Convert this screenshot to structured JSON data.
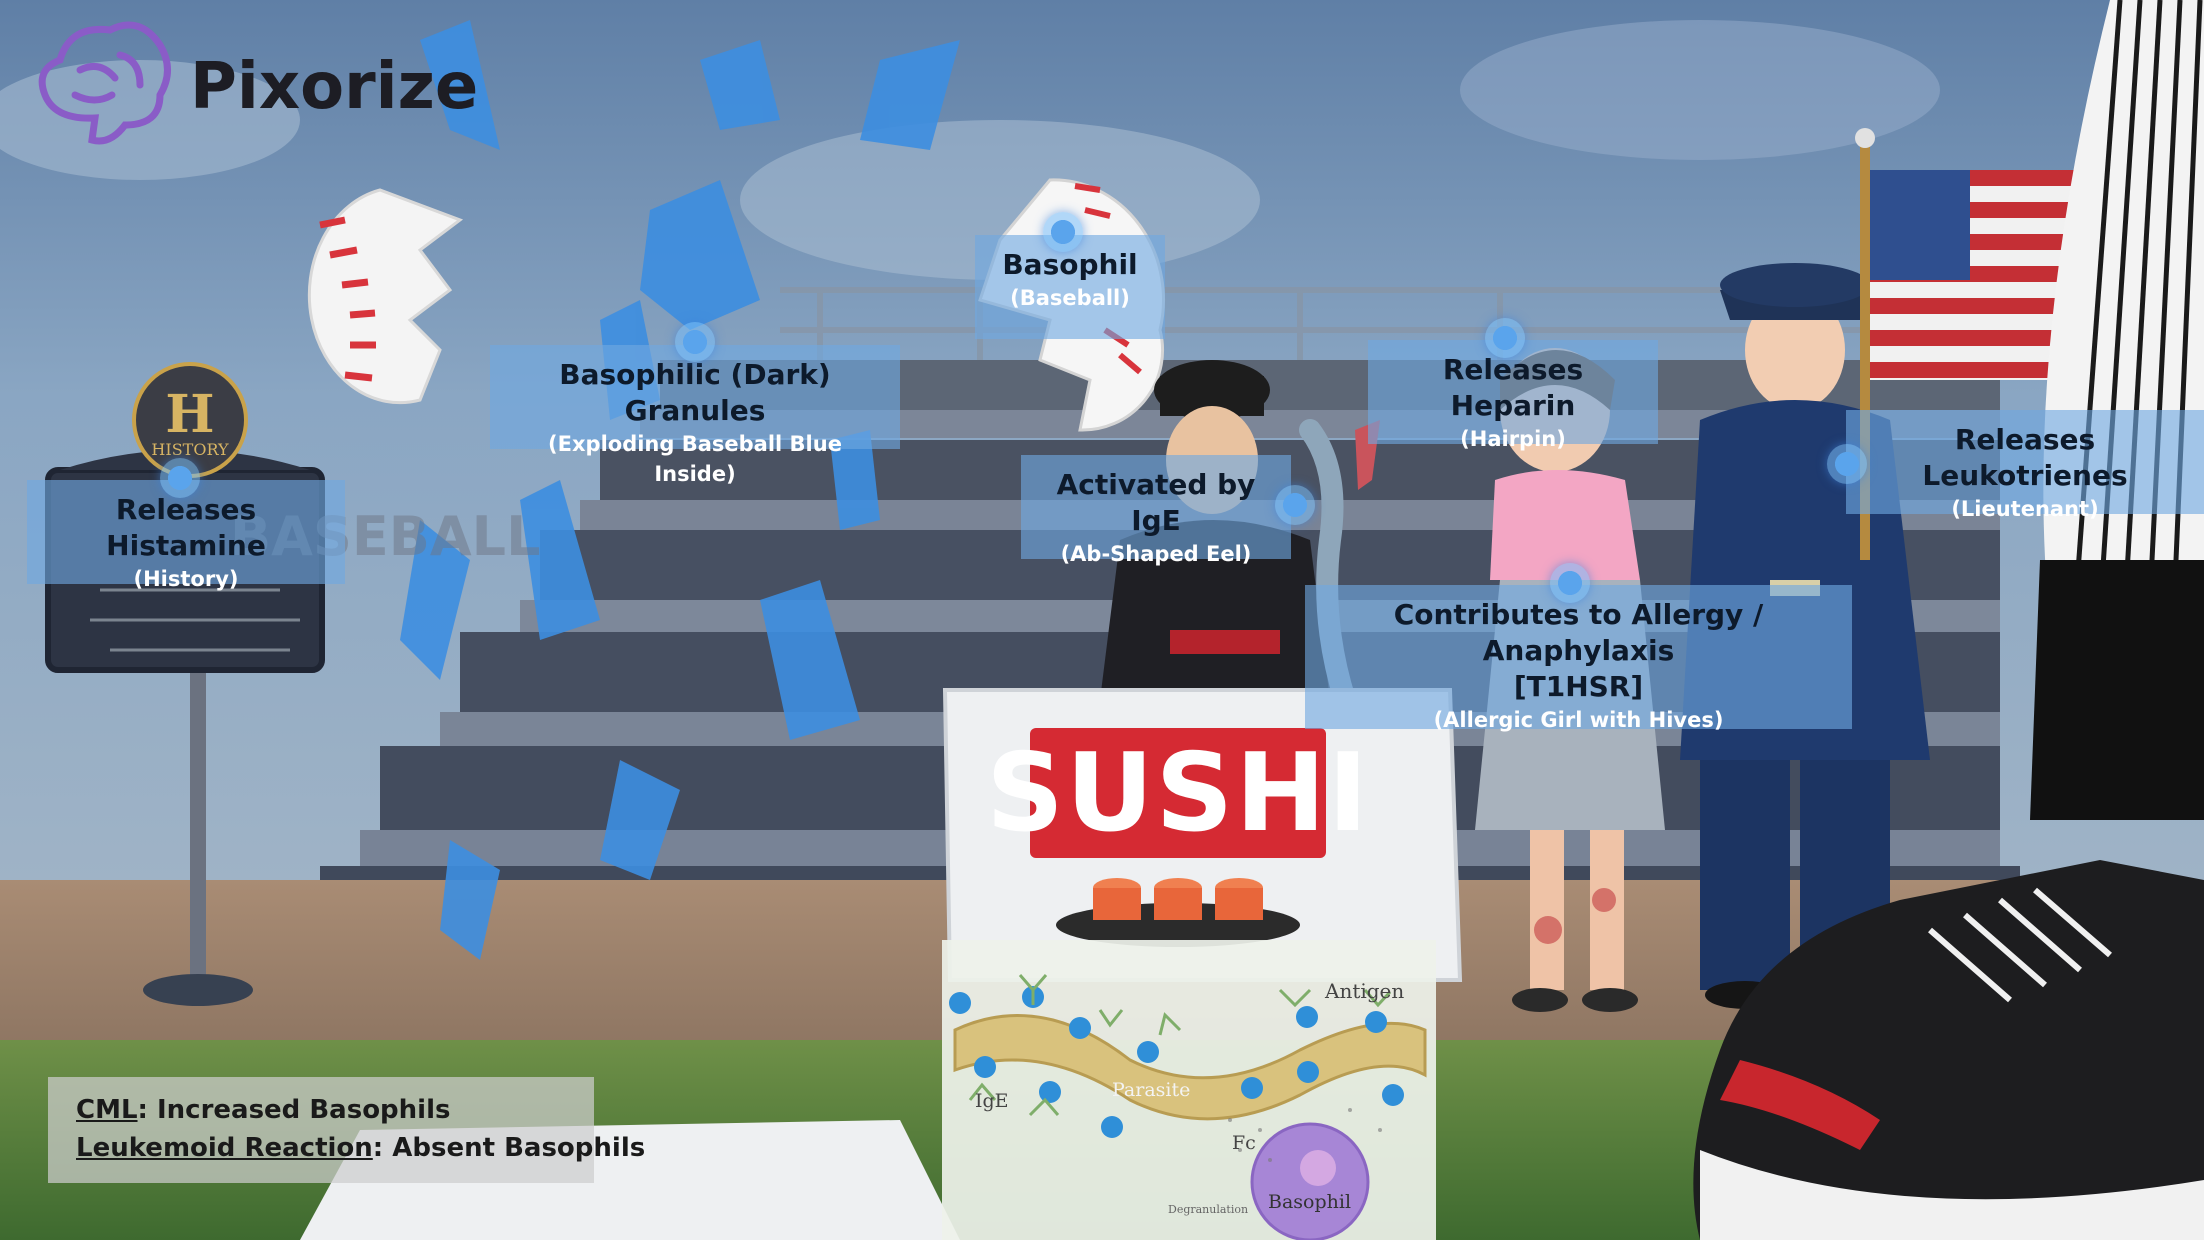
{
  "brand": {
    "name": "Pixorize"
  },
  "labels": {
    "basophil": {
      "title": "Basophil",
      "sub": "(Baseball)"
    },
    "granules": {
      "title": "Basophilic (Dark) Granules",
      "sub": "(Exploding Baseball Blue Inside)"
    },
    "heparin": {
      "title": "Releases Heparin",
      "sub": "(Hairpin)"
    },
    "histamine": {
      "title": "Releases Histamine",
      "sub": "(History)"
    },
    "ige": {
      "title": "Activated by IgE",
      "sub": "(Ab-Shaped Eel)"
    },
    "leukotrienes": {
      "title": "Releases Leukotrienes",
      "sub": "(Lieutenant)"
    },
    "allergy": {
      "title": "Contributes to Allergy / Anaphylaxis",
      "title2": "[T1HSR]",
      "sub": "(Allergic Girl with Hives)"
    }
  },
  "notes": {
    "cml_term": "CML",
    "cml_text": ": Increased Basophils",
    "leuk_term": "Leukemoid Reaction",
    "leuk_text": ": Absent Basophils"
  },
  "scene_text": {
    "sushi": "SUSHI",
    "history_sign": "HISTORY",
    "history_letter": "H",
    "stand_sign": "BASEBALL"
  },
  "diagram": {
    "antigen": "Antigen",
    "parasite": "Parasite",
    "ige": "IgE",
    "fc": "Fc",
    "basophil": "Basophil",
    "degranulation": "Degranulation"
  },
  "icons": [
    "brain-logo-icon",
    "hotspot-pin-icon"
  ],
  "colors": {
    "sky": "#6d8fb3",
    "label_bg": "#70a8e0",
    "pin": "#5aa4ec",
    "sushi_red": "#d52a33",
    "logo_purple": "#8a5cc7",
    "grass": "#5b7f3c"
  }
}
